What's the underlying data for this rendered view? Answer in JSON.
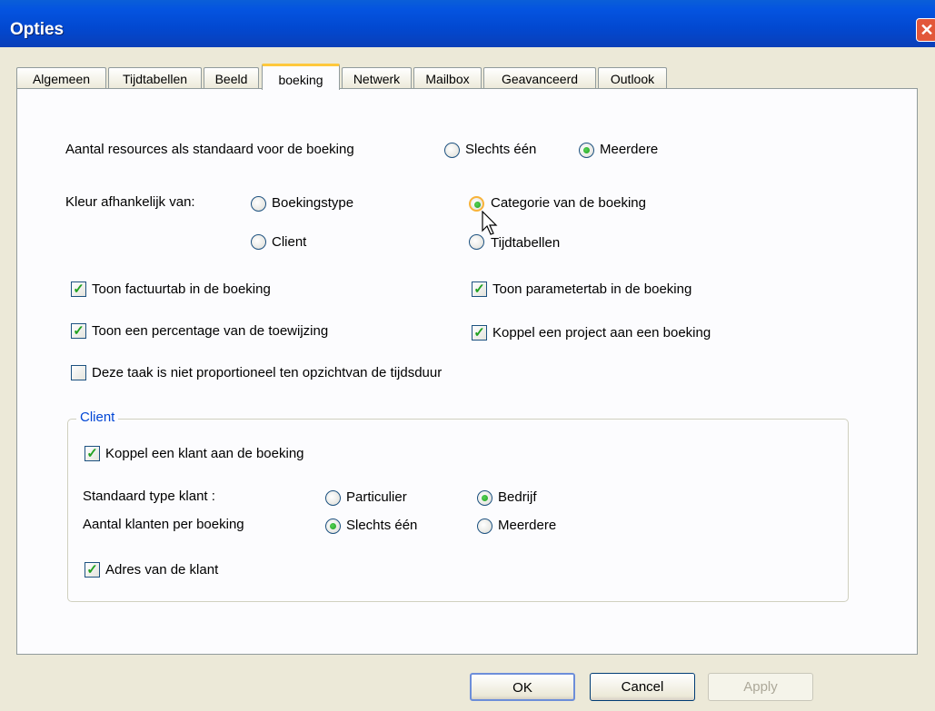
{
  "window": {
    "title": "Opties",
    "close_icon": "close-icon"
  },
  "tabs": [
    "Algemeen",
    "Tijdtabellen",
    "Beeld",
    "boeking",
    "Netwerk",
    "Mailbox",
    "Geavanceerd",
    "Outlook"
  ],
  "active_tab": "boeking",
  "resources": {
    "label": "Aantal resources als standaard voor de boeking",
    "option_one": "Slechts één",
    "option_many": "Meerdere",
    "selected": "Meerdere"
  },
  "color": {
    "label": "Kleur afhankelijk van:",
    "opt_type": "Boekingstype",
    "opt_category": "Categorie van de boeking",
    "opt_client": "Client",
    "opt_timetables": "Tijdtabellen",
    "selected": "Categorie van de boeking"
  },
  "checks": {
    "invoice_tab": {
      "label": "Toon factuurtab in de boeking",
      "checked": true
    },
    "param_tab": {
      "label": "Toon parametertab in de boeking",
      "checked": true
    },
    "percentage": {
      "label": "Toon een percentage van de toewijzing",
      "checked": true
    },
    "project": {
      "label": "Koppel een project aan een boeking",
      "checked": true
    },
    "proportional": {
      "label": "Deze taak is niet proportioneel ten opzichtvan de tijdsduur",
      "checked": false
    }
  },
  "client": {
    "legend": "Client",
    "link_client": {
      "label": "Koppel een klant aan de boeking",
      "checked": true
    },
    "type_label": "Standaard type klant :",
    "type_private": "Particulier",
    "type_company": "Bedrijf",
    "type_selected": "Bedrijf",
    "count_label": "Aantal klanten per boeking",
    "count_one": "Slechts één",
    "count_many": "Meerdere",
    "count_selected": "Slechts één",
    "address": {
      "label": "Adres van de klant",
      "checked": true
    }
  },
  "buttons": {
    "ok": "OK",
    "cancel": "Cancel",
    "apply": "Apply"
  },
  "colors": {
    "titlebar": "#0454e0",
    "dialog_bg": "#ece9d8",
    "panel_bg": "#fcfcfe",
    "active_tab_accent": "#ffc83c",
    "check_green": "#21a121",
    "group_label": "#0046d5"
  }
}
